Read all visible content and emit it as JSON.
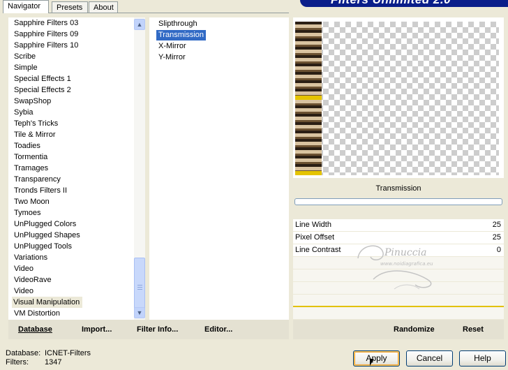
{
  "tabs": [
    "Navigator",
    "Presets",
    "About"
  ],
  "banner": "Filters Unlimited 2.0",
  "categories": [
    "Sapphire Filters 03",
    "Sapphire Filters 09",
    "Sapphire Filters 10",
    "Scribe",
    "Simple",
    "Special Effects 1",
    "Special Effects 2",
    "SwapShop",
    "Sybia",
    "Teph's Tricks",
    "Tile & Mirror",
    "Toadies",
    "Tormentia",
    "Tramages",
    "Transparency",
    "Tronds Filters II",
    "Two Moon",
    "Tymoes",
    "UnPlugged Colors",
    "UnPlugged Shapes",
    "UnPlugged Tools",
    "Variations",
    "Video",
    "VideoRave",
    "Video",
    "Visual Manipulation",
    "VM Distortion"
  ],
  "selected_category": "Visual Manipulation",
  "filters": [
    "Slipthrough",
    "Transmission",
    "X-Mirror",
    "Y-Mirror"
  ],
  "selected_filter": "Transmission",
  "preview_label": "Transmission",
  "params": [
    {
      "label": "Line Width",
      "value": "25"
    },
    {
      "label": "Pixel Offset",
      "value": "25"
    },
    {
      "label": "Line Contrast",
      "value": "0"
    }
  ],
  "left_buttons": {
    "database": "Database",
    "import": "Import...",
    "filter_info": "Filter Info...",
    "editor": "Editor..."
  },
  "right_buttons": {
    "randomize": "Randomize",
    "reset": "Reset"
  },
  "status": {
    "database_label": "Database:",
    "database_value": "ICNET-Filters",
    "filters_label": "Filters:",
    "filters_value": "1347"
  },
  "dialog_buttons": {
    "apply": "Apply",
    "cancel": "Cancel",
    "help": "Help"
  },
  "watermark": {
    "name": "Pinuccia",
    "url": "www.noidiagrafica.eu"
  },
  "colors": {
    "selection": "#316ac5",
    "banner": "#0a1e8a",
    "window": "#ece9d8"
  }
}
